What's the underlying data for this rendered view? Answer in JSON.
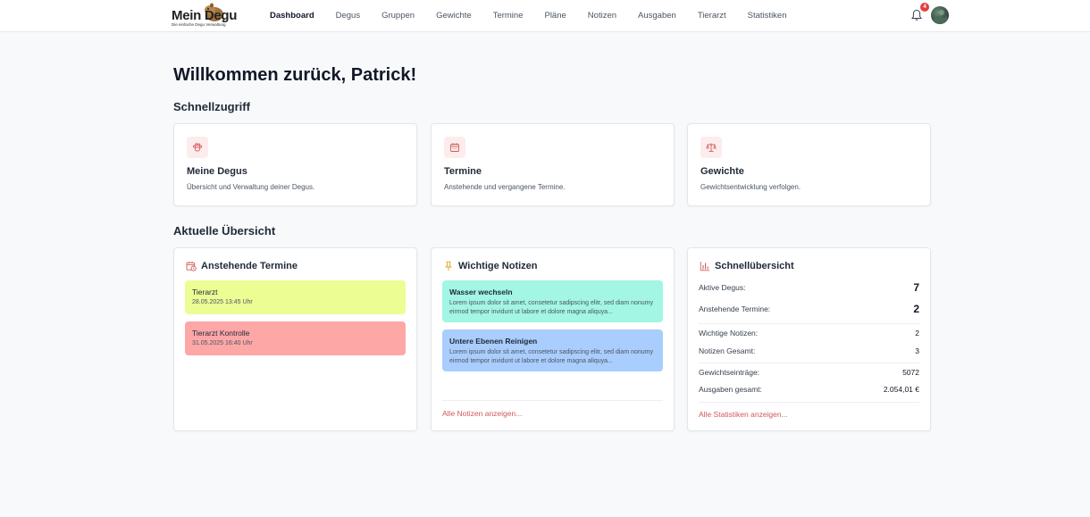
{
  "logo": {
    "title": "Mein Degu",
    "subtitle": "Die einfache Degu Verwaltung"
  },
  "nav": {
    "items": [
      "Dashboard",
      "Degus",
      "Gruppen",
      "Gewichte",
      "Termine",
      "Pläne",
      "Notizen",
      "Ausgaben",
      "Tierarzt",
      "Statistiken"
    ],
    "active": "Dashboard",
    "notification_count": "4"
  },
  "welcome": "Willkommen zurück, Patrick!",
  "quick": {
    "title": "Schnellzugriff",
    "cards": [
      {
        "title": "Meine Degus",
        "desc": "Übersicht und Verwaltung deiner Degus.",
        "icon": "paw-icon"
      },
      {
        "title": "Termine",
        "desc": "Anstehende und vergangene Termine.",
        "icon": "calendar-icon"
      },
      {
        "title": "Gewichte",
        "desc": "Gewichtsentwicklung verfolgen.",
        "icon": "scale-icon"
      }
    ]
  },
  "overview": {
    "title": "Aktuelle Übersicht",
    "appointments": {
      "title": "Anstehende Termine",
      "items": [
        {
          "title": "Tierarzt",
          "date": "28.05.2025 13:45 Uhr",
          "color": "#ecfd94"
        },
        {
          "title": "Tierarzt Kontrolle",
          "date": "31.05.2025 16:40 Uhr",
          "color": "#fda7a7"
        }
      ]
    },
    "notes": {
      "title": "Wichtige Notizen",
      "items": [
        {
          "title": "Wasser wechseln",
          "text": "Lorem ipsum dolor sit amet, consetetur sadipscing elitr, sed diam nonumy eirmod tempor invidunt ut labore et dolore magna aliquya...",
          "color": "#a2f6e3"
        },
        {
          "title": "Untere Ebenen Reinigen",
          "text": "Lorem ipsum dolor sit amet, consetetur sadipscing elitr, sed diam nonumy eirmod tempor invidunt ut labore et dolore magna aliquya...",
          "color": "#a9cdfd"
        }
      ],
      "link": "Alle Notizen anzeigen..."
    },
    "stats": {
      "title": "Schnellübersicht",
      "rows": [
        {
          "label": "Aktive Degus:",
          "value": "7"
        },
        {
          "label": "Anstehende Termine:",
          "value": "2"
        },
        {
          "label": "Wichtige Notizen:",
          "value": "2"
        },
        {
          "label": "Notizen Gesamt:",
          "value": "3"
        },
        {
          "label": "Gewichtseinträge:",
          "value": "5072"
        },
        {
          "label": "Ausgaben gesamt:",
          "value": "2.054,01 €"
        }
      ],
      "link": "Alle Statistiken anzeigen..."
    }
  },
  "colors": {
    "accent": "#d05a5a",
    "badge": "#e53e3e"
  }
}
